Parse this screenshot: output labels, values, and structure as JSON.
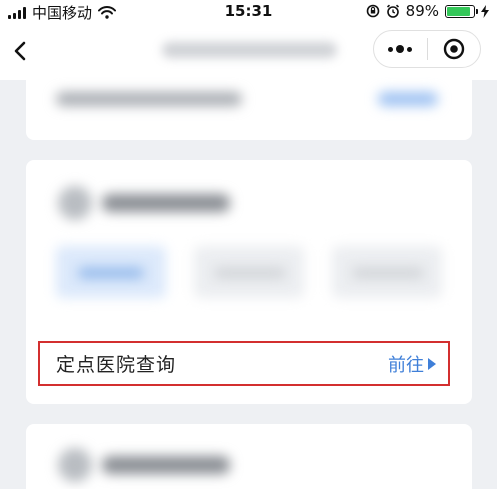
{
  "status_bar": {
    "carrier": "中国移动",
    "time": "15:31",
    "battery": "89%",
    "battery_level": 0.89
  },
  "nav": {
    "back_icon": "chevron-left-icon",
    "more_icon": "more-dots-icon",
    "close_icon": "target-circle-icon"
  },
  "hospital_query": {
    "label": "定点医院查询",
    "go_label": "前往",
    "arrow_icon": "triangle-right-icon"
  },
  "colors": {
    "accent": "#3f7fd8",
    "highlight_border": "#d32f2f",
    "battery_green": "#34c759"
  }
}
